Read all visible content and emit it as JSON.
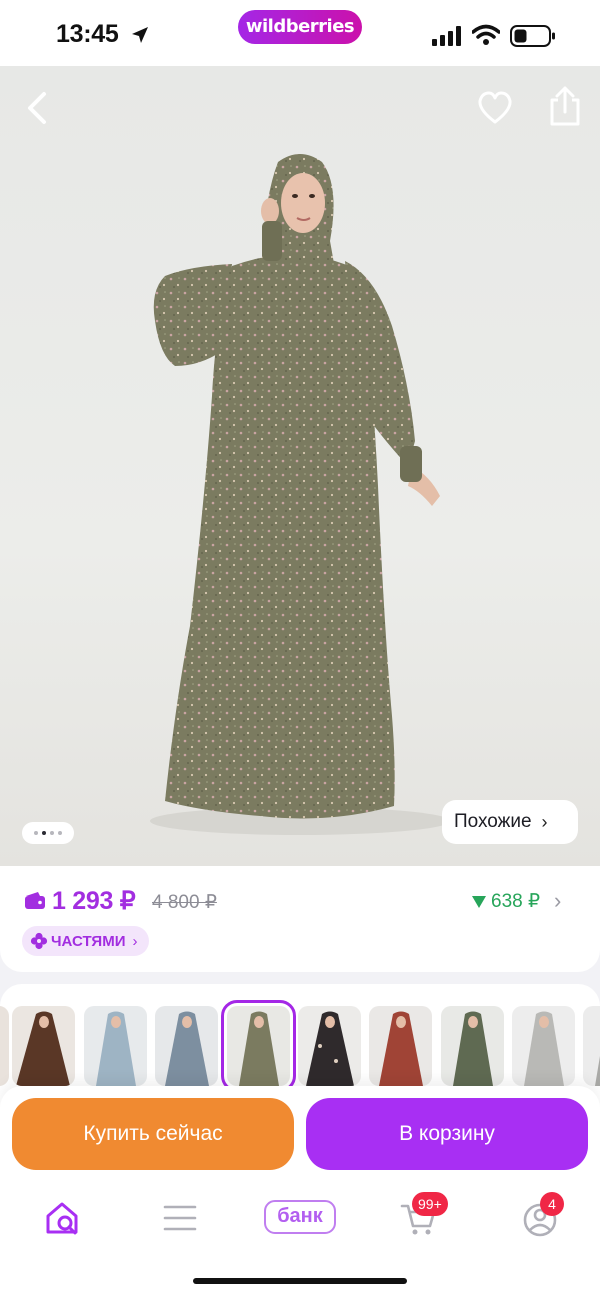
{
  "status_bar": {
    "time": "13:45",
    "brand": "wildberries"
  },
  "hero": {
    "similar_label": "Похожие",
    "slide_count": 4,
    "active_slide": 1
  },
  "price": {
    "current": "1 293 ₽",
    "old": "4 800 ₽",
    "discount": "638 ₽",
    "installments_label": "ЧАСТЯМИ"
  },
  "thumbnails": {
    "count": 10,
    "selected_index": 4
  },
  "actions": {
    "buy_now": "Купить сейчас",
    "add_to_cart": "В корзину"
  },
  "tabbar": {
    "bank_label": "банк",
    "cart_badge": "99+",
    "profile_badge": "4"
  },
  "colors": {
    "brand_purple": "#a82ff3",
    "buy_orange": "#f08a31",
    "discount_green": "#27a55a",
    "badge_red": "#f02746"
  }
}
